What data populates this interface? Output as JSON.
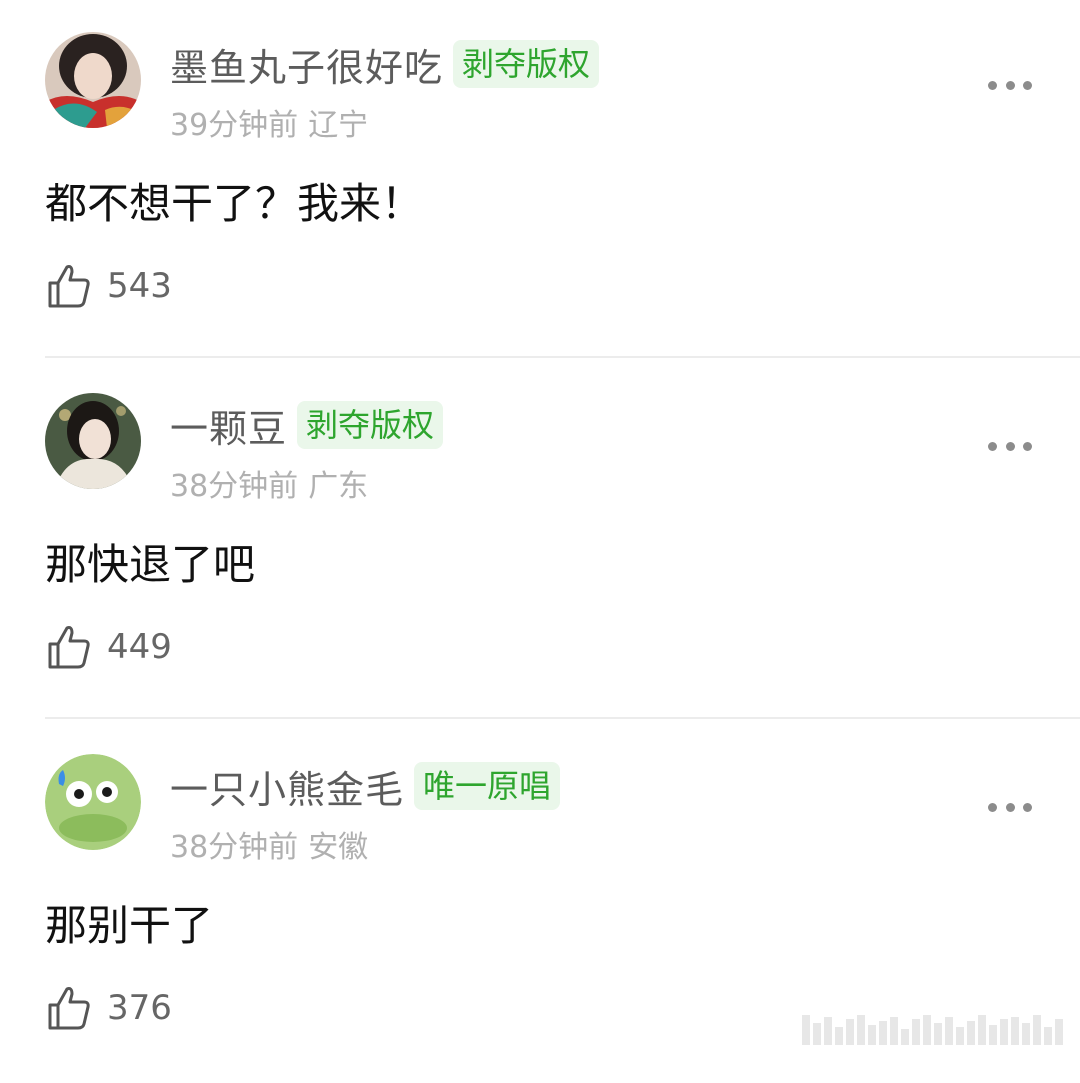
{
  "comments": [
    {
      "username": "墨鱼丸子很好吃",
      "badge": "剥夺版权",
      "time": "39分钟前",
      "location": "辽宁",
      "content": "都不想干了？我来！",
      "likes": "543",
      "avatar_icon": "avatar-woman-scarf"
    },
    {
      "username": "一颗豆",
      "badge": "剥夺版权",
      "time": "38分钟前",
      "location": "广东",
      "content": "那快退了吧",
      "likes": "449",
      "avatar_icon": "avatar-woman-portrait"
    },
    {
      "username": "一只小熊金毛",
      "badge": "唯一原唱",
      "time": "38分钟前",
      "location": "安徽",
      "content": "那别干了",
      "likes": "376",
      "avatar_icon": "avatar-green-alien"
    }
  ],
  "colors": {
    "badge_bg": "#eaf7ea",
    "badge_text": "#2ea52e",
    "username": "#5c5c5c",
    "meta": "#b0b0b0"
  },
  "icons": {
    "like": "thumbs-up-icon",
    "more": "more-dots-icon"
  }
}
